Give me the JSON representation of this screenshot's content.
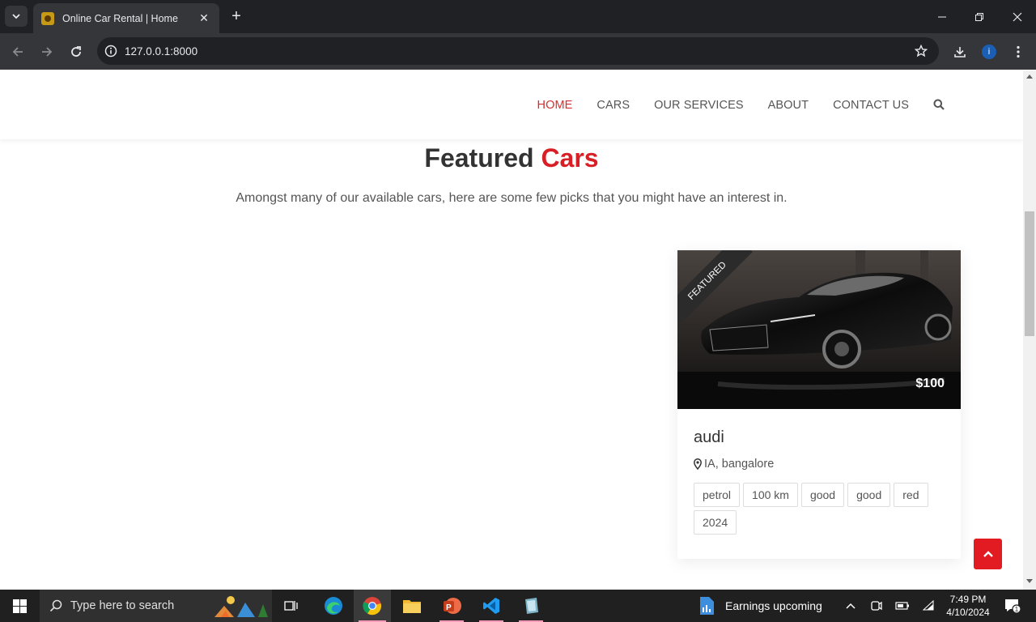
{
  "browser": {
    "tab_title": "Online Car Rental | Home",
    "url": "127.0.0.1:8000",
    "profile_initial": "i"
  },
  "nav": {
    "items": [
      "HOME",
      "CARS",
      "OUR SERVICES",
      "ABOUT",
      "CONTACT US"
    ],
    "active": "HOME"
  },
  "featured": {
    "title_main": "Featured",
    "title_accent": "Cars",
    "subtitle": "Amongst many of our available cars, here are some few picks that you might have an interest in."
  },
  "car": {
    "ribbon": "FEATURED",
    "price": "$100",
    "name": "audi",
    "location": "IA, bangalore",
    "tags": [
      "petrol",
      "100 km",
      "good",
      "good",
      "red",
      "2024"
    ]
  },
  "taskbar": {
    "search_placeholder": "Type here to search",
    "news": "Earnings upcoming",
    "time": "7:49 PM",
    "date": "4/10/2024",
    "notifications": "1"
  },
  "colors": {
    "accent_red": "#d81f26",
    "nav_active": "#d62e2e"
  }
}
